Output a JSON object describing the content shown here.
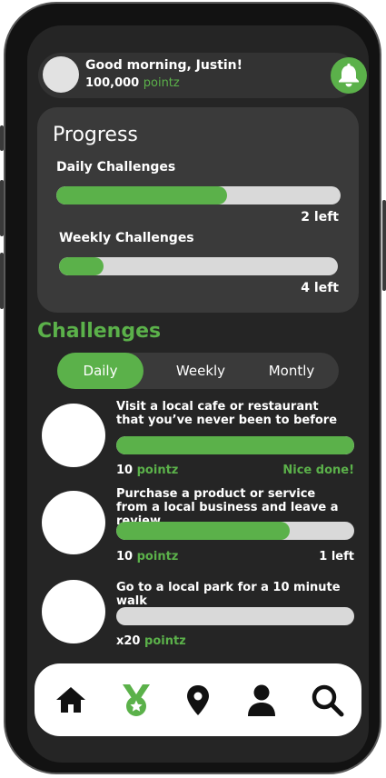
{
  "header": {
    "greeting": "Good morning, Justin!",
    "points_value": "100,000",
    "points_unit": "pointz",
    "bell_icon": "bell-icon"
  },
  "progress": {
    "title": "Progress",
    "daily": {
      "label": "Daily Challenges",
      "fraction": 0.6,
      "left_text": "2 left"
    },
    "weekly": {
      "label": "Weekly Challenges",
      "fraction": 0.16,
      "left_text": "4 left"
    }
  },
  "challenges": {
    "title": "Challenges",
    "tabs": [
      {
        "label": "Daily",
        "active": true
      },
      {
        "label": "Weekly",
        "active": false
      },
      {
        "label": "Montly",
        "active": false
      }
    ],
    "items": [
      {
        "text": "Visit a local cafe or restaurant that you’ve never been to before",
        "points": "10",
        "points_unit": "pointz",
        "fraction": 1.0,
        "status": "Nice done!"
      },
      {
        "text": "Purchase a product or service from a local business and leave a review",
        "points": "10",
        "points_unit": "pointz",
        "fraction": 0.73,
        "status": "1 left"
      },
      {
        "text": "Go to a local park for a 10 minute walk",
        "points": "x20",
        "points_unit": "pointz",
        "fraction": 0.0,
        "status": ""
      }
    ]
  },
  "nav": {
    "items": [
      {
        "icon": "home-icon",
        "active": false
      },
      {
        "icon": "medal-icon",
        "active": true
      },
      {
        "icon": "location-pin-icon",
        "active": false
      },
      {
        "icon": "user-icon",
        "active": false
      },
      {
        "icon": "search-icon",
        "active": false
      }
    ]
  },
  "colors": {
    "accent": "#5bb14a",
    "background": "#252525",
    "card": "#3a3a3a",
    "track": "#d9d9d9"
  }
}
